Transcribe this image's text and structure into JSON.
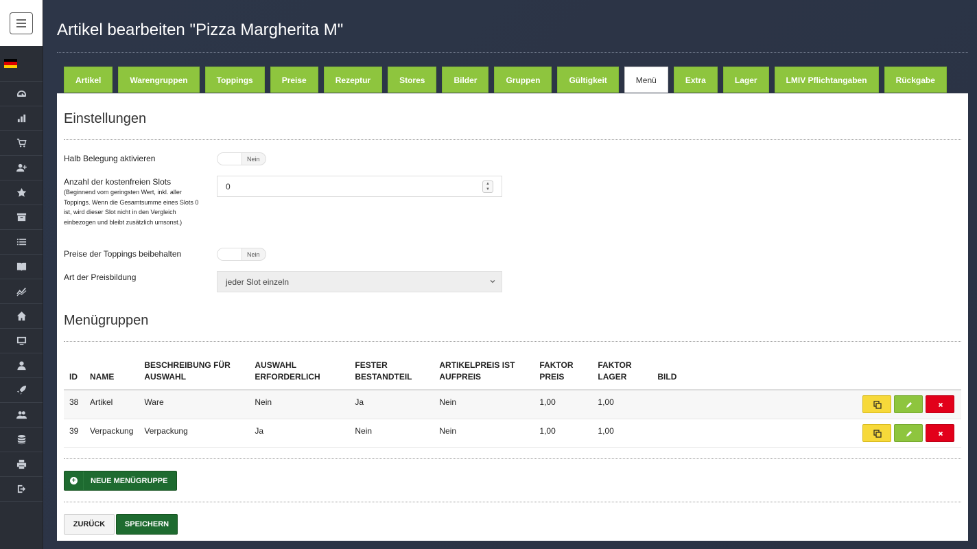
{
  "page": {
    "title": "Artikel bearbeiten \"Pizza Margherita M\""
  },
  "colors": {
    "accent_green": "#8ec53e",
    "dark_green": "#1e6b30",
    "warning_yellow": "#f7d93a",
    "danger_red": "#e2001a",
    "sidebar_bg": "#2a2e36"
  },
  "sidebar": {
    "items": [
      {
        "icon": "dashboard-gauge-icon"
      },
      {
        "icon": "bar-chart-icon"
      },
      {
        "icon": "shopping-cart-icon"
      },
      {
        "icon": "add-user-icon"
      },
      {
        "icon": "star-icon"
      },
      {
        "icon": "archive-box-icon"
      },
      {
        "icon": "list-icon"
      },
      {
        "icon": "book-icon"
      },
      {
        "icon": "trend-line-icon"
      },
      {
        "icon": "home-icon"
      },
      {
        "icon": "monitor-icon"
      },
      {
        "icon": "user-icon"
      },
      {
        "icon": "rocket-icon"
      },
      {
        "icon": "users-icon"
      },
      {
        "icon": "database-icon"
      },
      {
        "icon": "printer-icon"
      },
      {
        "icon": "logout-icon"
      }
    ]
  },
  "tabs": [
    {
      "label": "Artikel",
      "active": false
    },
    {
      "label": "Warengruppen",
      "active": false
    },
    {
      "label": "Toppings",
      "active": false
    },
    {
      "label": "Preise",
      "active": false
    },
    {
      "label": "Rezeptur",
      "active": false
    },
    {
      "label": "Stores",
      "active": false
    },
    {
      "label": "Bilder",
      "active": false
    },
    {
      "label": "Gruppen",
      "active": false
    },
    {
      "label": "Gültigkeit",
      "active": false
    },
    {
      "label": "Menü",
      "active": true
    },
    {
      "label": "Extra",
      "active": false
    },
    {
      "label": "Lager",
      "active": false
    },
    {
      "label": "LMIV Pflichtangaben",
      "active": false
    },
    {
      "label": "Rückgabe",
      "active": false
    }
  ],
  "settings": {
    "title": "Einstellungen",
    "half_topping": {
      "label": "Halb Belegung aktivieren",
      "value": "Nein"
    },
    "free_slots": {
      "label": "Anzahl der kostenfreien Slots",
      "help": "(Beginnend vom geringsten Wert, inkl. aller Toppings. Wenn die Gesamtsumme eines Slots 0 ist, wird dieser Slot nicht in den Vergleich einbezogen und bleibt zusätzlich umsonst.)",
      "value": "0"
    },
    "keep_prices": {
      "label": "Preise der Toppings beibehalten",
      "value": "Nein"
    },
    "pricing_type": {
      "label": "Art der Preisbildung",
      "value": "jeder Slot einzeln"
    }
  },
  "menu_groups": {
    "title": "Menügruppen",
    "columns": [
      "ID",
      "NAME",
      "BESCHREIBUNG FÜR AUSWAHL",
      "AUSWAHL ERFORDERLICH",
      "FESTER BESTANDTEIL",
      "ARTIKELPREIS IST AUFPREIS",
      "FAKTOR PREIS",
      "FAKTOR LAGER",
      "BILD"
    ],
    "rows": [
      {
        "id": "38",
        "name": "Artikel",
        "description": "Ware",
        "required": "Nein",
        "fixed": "Ja",
        "surcharge": "Nein",
        "factor_price": "1,00",
        "factor_stock": "1,00",
        "image": ""
      },
      {
        "id": "39",
        "name": "Verpackung",
        "description": "Verpackung",
        "required": "Ja",
        "fixed": "Nein",
        "surcharge": "Nein",
        "factor_price": "1,00",
        "factor_stock": "1,00",
        "image": ""
      }
    ],
    "new_button": "NEUE MENÜGRUPPE"
  },
  "footer": {
    "back": "ZURÜCK",
    "save": "SPEICHERN"
  }
}
